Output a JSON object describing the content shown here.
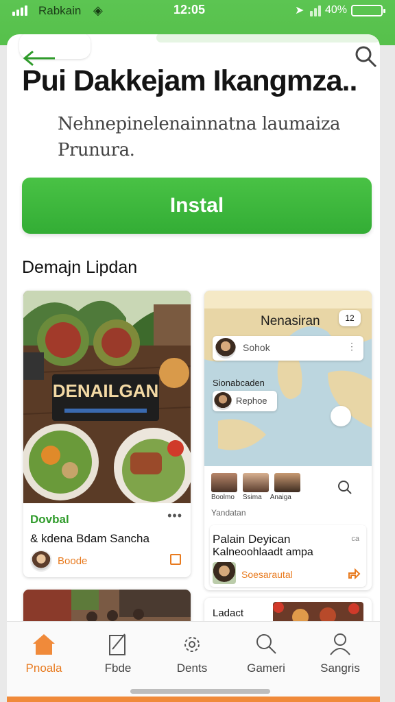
{
  "status_bar": {
    "carrier": "Rabkain",
    "time": "12:05",
    "battery": "40%"
  },
  "header": {
    "back_icon": "arrow-left-icon",
    "search_icon": "search-icon"
  },
  "app": {
    "title": "Pui Dakkejam Ikangmza..",
    "description": "Nehnepinelenainnatna laumaiza Prunura.",
    "install_label": "Instal"
  },
  "section": {
    "title": "Demajn Lipdan"
  },
  "cards": {
    "left": {
      "sign_text": "DENAILGAN",
      "category": "Dovbal",
      "subtitle": "& kdena Bdam Sancha",
      "author": "Boode"
    },
    "right": {
      "map_title": "Nenasiran",
      "map_badge": "12",
      "search_text": "Sohok",
      "map_label": "Sionabcaden",
      "chip_text": "Rephoe",
      "people_labels": [
        "Boolmo",
        "Ssima",
        "Anaiga"
      ],
      "caption": "Yandatan",
      "inner_title": "Palain Deyican",
      "inner_subtitle": "Kalneoohlaadt ampa",
      "inner_meta": "ca",
      "inner_author": "Soesarautal"
    },
    "bottom_right": {
      "title": "Ladact"
    }
  },
  "bottom_nav": {
    "items": [
      {
        "label": "Pnoala",
        "icon": "home-icon"
      },
      {
        "label": "Fbde",
        "icon": "edit-icon"
      },
      {
        "label": "Dents",
        "icon": "gear-icon"
      },
      {
        "label": "Gameri",
        "icon": "search-icon"
      },
      {
        "label": "Sangris",
        "icon": "profile-icon"
      }
    ]
  },
  "colors": {
    "brand_green": "#3db53b",
    "accent_orange": "#e87a1e"
  }
}
